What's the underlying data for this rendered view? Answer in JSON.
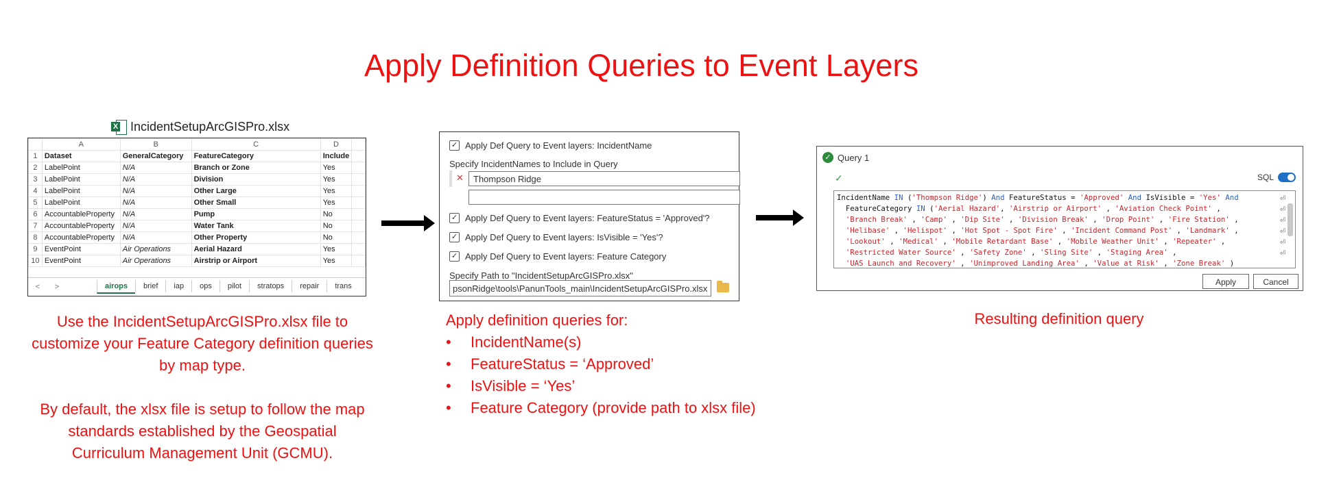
{
  "title": "Apply Definition Queries to Event Layers",
  "excel": {
    "filename": "IncidentSetupArcGISPro.xlsx",
    "col_letters": [
      "A",
      "B",
      "C",
      "D"
    ],
    "rows": [
      [
        "1",
        "Dataset",
        "GeneralCategory",
        "FeatureCategory",
        "Include"
      ],
      [
        "2",
        "LabelPoint",
        "N/A",
        "Branch or Zone",
        "Yes"
      ],
      [
        "3",
        "LabelPoint",
        "N/A",
        "Division",
        "Yes"
      ],
      [
        "4",
        "LabelPoint",
        "N/A",
        "Other Large",
        "Yes"
      ],
      [
        "5",
        "LabelPoint",
        "N/A",
        "Other Small",
        "Yes"
      ],
      [
        "6",
        "AccountableProperty",
        "N/A",
        "Pump",
        "No"
      ],
      [
        "7",
        "AccountableProperty",
        "N/A",
        "Water Tank",
        "No"
      ],
      [
        "8",
        "AccountableProperty",
        "N/A",
        "Other Property",
        "No"
      ],
      [
        "9",
        "EventPoint",
        "Air Operations",
        "Aerial Hazard",
        "Yes"
      ],
      [
        "10",
        "EventPoint",
        "Air Operations",
        "Airstrip or Airport",
        "Yes"
      ]
    ],
    "tabs": [
      "airops",
      "brief",
      "iap",
      "ops",
      "pilot",
      "stratops",
      "repair",
      "trans"
    ],
    "active_tab": "airops",
    "nav_prev": "<",
    "nav_next": ">"
  },
  "settings": {
    "chk1": "Apply Def Query to Event layers: IncidentName",
    "specify_names": "Specify IncidentNames to Include in Query",
    "incident_value": "Thompson Ridge",
    "incident_empty": "",
    "chk2": "Apply Def Query to Event layers: FeatureStatus = 'Approved'?",
    "chk3": "Apply Def Query to Event layers: IsVisible = 'Yes'?",
    "chk4": "Apply Def Query to Event layers: Feature Category",
    "path_label": "Specify Path to \"IncidentSetupArcGISPro.xlsx\"",
    "path_value": "psonRidge\\tools\\PanunTools_main\\IncidentSetupArcGISPro.xlsx",
    "check_glyph": "✓",
    "remove_glyph": "✕"
  },
  "query": {
    "header": "Query 1",
    "sql_label": "SQL",
    "apply": "Apply",
    "cancel": "Cancel",
    "text": "IncidentName IN ('Thompson Ridge') And FeatureStatus = 'Approved' And IsVisible = 'Yes' And FeatureCategory IN ('Aerial Hazard', 'Airstrip or Airport', 'Aviation Check Point', 'Branch Break', 'Camp', 'Dip Site', 'Division Break', 'Drop Point', 'Fire Station', 'Helibase', 'Helispot', 'Hot Spot - Spot Fire', 'Incident Command Post', 'Landmark', 'Lookout', 'Medical', 'Mobile Retardant Base', 'Mobile Weather Unit', 'Repeater', 'Restricted Water Source', 'Safety Zone', 'Sling Site', 'Staging Area', 'UAS Launch and Recovery', 'Unimproved Landing Area', 'Value at Risk', 'Zone Break')"
  },
  "captions": {
    "left_p1": "Use the IncidentSetupArcGISPro.xlsx file to customize your Feature Category definition queries by map type.",
    "left_p2": "By default, the xlsx file is setup to follow the map standards established by the Geospatial Curriculum Management Unit (GCMU).",
    "mid_intro": "Apply definition queries for:",
    "mid_items": [
      "IncidentName(s)",
      "FeatureStatus = ‘Approved’",
      "IsVisible = ‘Yes’",
      "Feature Category (provide path to xlsx file)"
    ],
    "right": "Resulting definition query"
  }
}
